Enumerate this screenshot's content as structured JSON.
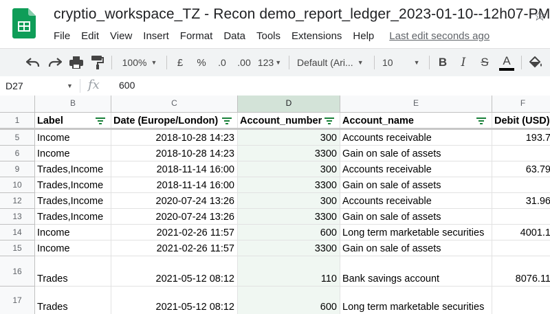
{
  "app": {
    "title": "cryptio_workspace_TZ - Recon demo_report_ledger_2023-01-10--12h07-PM"
  },
  "menu": [
    "File",
    "Edit",
    "View",
    "Insert",
    "Format",
    "Data",
    "Tools",
    "Extensions",
    "Help"
  ],
  "last_edit": "Last edit seconds ago",
  "toolbar": {
    "zoom": "100%",
    "currency": "£",
    "percent": "%",
    "dec_decrease": ".0",
    "dec_increase": ".00",
    "number_format": "123",
    "font": "Default (Ari...",
    "font_size": "10"
  },
  "formula_bar": {
    "cell_ref": "D27",
    "fx": "fx",
    "value": "600"
  },
  "columns": [
    {
      "letter": "B",
      "header": "Label",
      "filter": true
    },
    {
      "letter": "C",
      "header": "Date (Europe/London)",
      "filter": true
    },
    {
      "letter": "D",
      "header": "Account_number",
      "filter": true
    },
    {
      "letter": "E",
      "header": "Account_name",
      "filter": true
    },
    {
      "letter": "F",
      "header": "Debit (USD)",
      "filter": false
    }
  ],
  "header_row_number": "1",
  "rows": [
    {
      "num": "5",
      "label": "Income",
      "date": "2018-10-28 14:23",
      "acct_no": "300",
      "acct_name": "Accounts receivable",
      "debit": "193.7"
    },
    {
      "num": "6",
      "label": "Income",
      "date": "2018-10-28 14:23",
      "acct_no": "3300",
      "acct_name": "Gain on sale of assets",
      "debit": ""
    },
    {
      "num": "9",
      "label": "Trades,Income",
      "date": "2018-11-14 16:00",
      "acct_no": "300",
      "acct_name": "Accounts receivable",
      "debit": "63.79"
    },
    {
      "num": "10",
      "label": "Trades,Income",
      "date": "2018-11-14 16:00",
      "acct_no": "3300",
      "acct_name": "Gain on sale of assets",
      "debit": ""
    },
    {
      "num": "12",
      "label": "Trades,Income",
      "date": "2020-07-24 13:26",
      "acct_no": "300",
      "acct_name": "Accounts receivable",
      "debit": "31.96"
    },
    {
      "num": "13",
      "label": "Trades,Income",
      "date": "2020-07-24 13:26",
      "acct_no": "3300",
      "acct_name": "Gain on sale of assets",
      "debit": ""
    },
    {
      "num": "14",
      "label": "Income",
      "date": "2021-02-26 11:57",
      "acct_no": "600",
      "acct_name": "Long term marketable securities",
      "debit": "4001.1"
    },
    {
      "num": "15",
      "label": "Income",
      "date": "2021-02-26 11:57",
      "acct_no": "3300",
      "acct_name": "Gain on sale of assets",
      "debit": ""
    },
    {
      "num": "16",
      "label": "Trades",
      "date": "2021-05-12 08:12",
      "acct_no": "110",
      "acct_name": "Bank savings account",
      "debit": "8076.11"
    },
    {
      "num": "17",
      "label": "Trades",
      "date": "2021-05-12 08:12",
      "acct_no": "600",
      "acct_name": "Long term marketable securities",
      "debit": ""
    }
  ],
  "colors": {
    "sheets_green": "#188038",
    "selected_col": "#d3e3d8",
    "toolbar_bg": "#f1f3f4"
  }
}
